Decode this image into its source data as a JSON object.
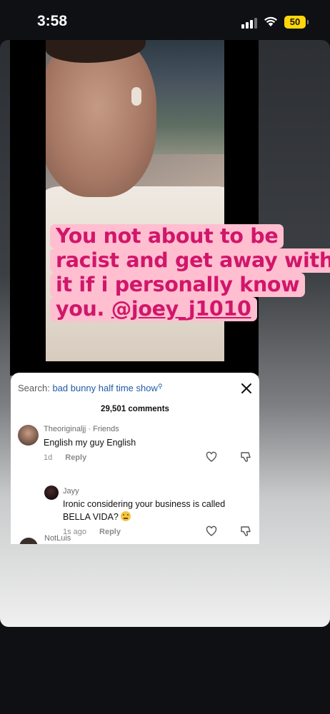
{
  "status_bar": {
    "time": "3:58",
    "battery": "50",
    "battery_color": "#ffd60a"
  },
  "story": {
    "caption": {
      "lines": [
        "You not about to be",
        "racist and get away with",
        "it if i personally know",
        "you. "
      ],
      "mention": "@joey_j1010",
      "text_color": "#d1166a",
      "background_color": "#ffbfd0"
    }
  },
  "comments_panel": {
    "search_label": "Search:",
    "search_query": "bad bunny half time show",
    "search_icon": "search-icon",
    "close_icon": "close-icon",
    "comment_count": "29,501 comments",
    "comments": [
      {
        "username": "Theoriginaljj",
        "relation": "· Friends",
        "text": "English my guy English",
        "time": "1d",
        "reply_label": "Reply"
      }
    ],
    "reply": {
      "username": "Jayy",
      "text_line1": "Ironic considering your business is called",
      "text_line2": "BELLA VIDA?",
      "time": "1s ago",
      "reply_label": "Reply",
      "emoji": "thinking-face-emoji"
    },
    "partial_next_username": "NotLuis"
  }
}
